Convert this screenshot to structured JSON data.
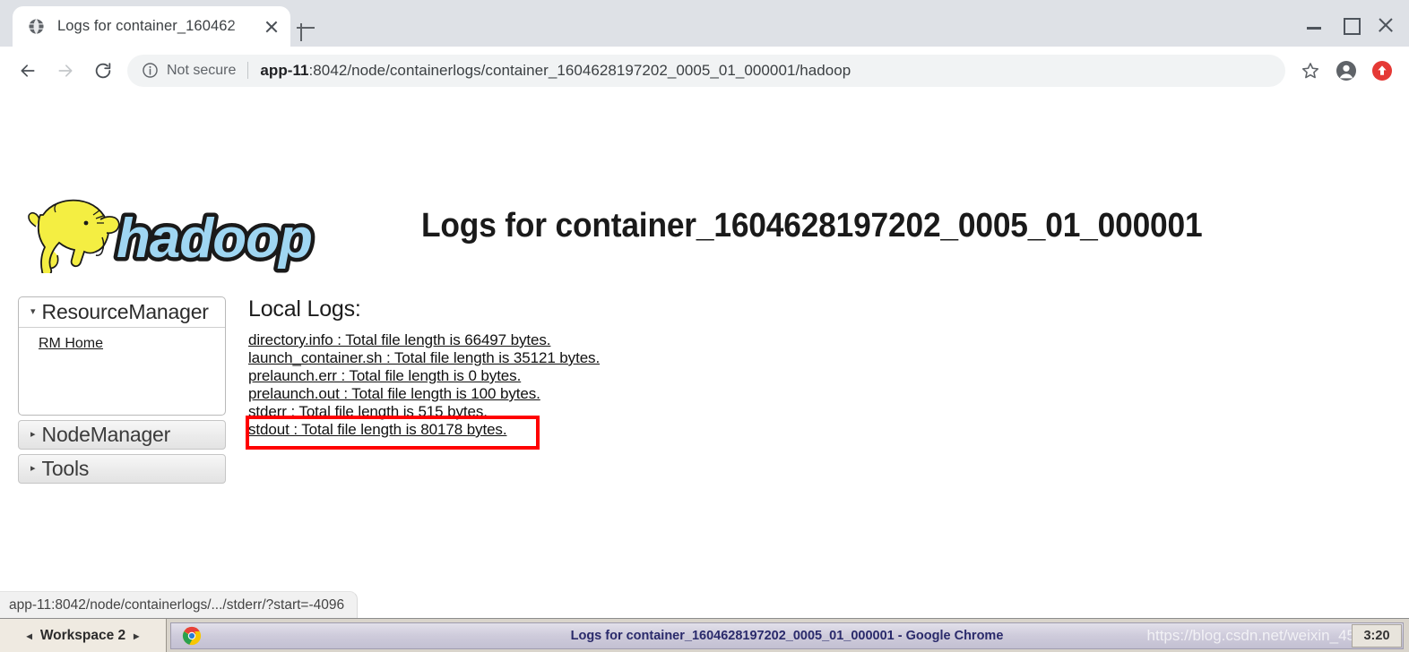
{
  "browser": {
    "tab": {
      "title": "Logs for container_160462",
      "favicon": "globe-icon",
      "close": "×"
    },
    "new_tab_label": "+",
    "window_controls": {
      "minimize": "minimize-icon",
      "maximize": "maximize-icon",
      "close": "close-icon"
    },
    "nav": {
      "back": "back-arrow-icon",
      "forward": "forward-arrow-icon",
      "reload": "reload-icon"
    },
    "omnibox": {
      "security_icon": "info-circle-icon",
      "security_label": "Not secure",
      "url_host": "app-11",
      "url_rest": ":8042/node/containerlogs/container_1604628197202_0005_01_000001/hadoop",
      "url_full": "app-11:8042/node/containerlogs/container_1604628197202_0005_01_000001/hadoop"
    },
    "toolbar_icons": {
      "bookmark": "star-icon",
      "profile": "avatar-icon",
      "update": "update-icon"
    },
    "status_bar": {
      "text": "app-11:8042/node/containerlogs/.../stderr/?start=-4096"
    }
  },
  "page": {
    "logo_alt": "hadoop-logo",
    "title": "Logs for container_1604628197202_0005_01_000001",
    "sidebar": {
      "expanded": {
        "caret": "▾",
        "label": "ResourceManager",
        "links": [
          {
            "label": "RM Home",
            "name": "rm-home-link"
          }
        ]
      },
      "collapsed": [
        {
          "caret": "▸",
          "label": "NodeManager",
          "name": "sidebar-section-nodemanager"
        },
        {
          "caret": "▸",
          "label": "Tools",
          "name": "sidebar-section-tools"
        }
      ]
    },
    "main": {
      "heading": "Local Logs:",
      "logs": [
        {
          "label": "directory.info : Total file length is 66497 bytes.",
          "file": "directory.info",
          "bytes": 66497
        },
        {
          "label": "launch_container.sh : Total file length is 35121 bytes.",
          "file": "launch_container.sh",
          "bytes": 35121
        },
        {
          "label": "prelaunch.err : Total file length is 0 bytes.",
          "file": "prelaunch.err",
          "bytes": 0
        },
        {
          "label": "prelaunch.out : Total file length is 100 bytes.",
          "file": "prelaunch.out",
          "bytes": 100
        },
        {
          "label": "stderr : Total file length is 515 bytes.",
          "file": "stderr",
          "bytes": 515
        },
        {
          "label": "stdout : Total file length is 80178 bytes.",
          "file": "stdout",
          "bytes": 80178
        }
      ],
      "highlight": {
        "color": "#ff0000",
        "target": "stdout : Total file length is 80178 bytes."
      }
    }
  },
  "taskbar": {
    "workspace": {
      "prev": "◂",
      "label": "Workspace 2",
      "next": "▸"
    },
    "task": {
      "icon": "chrome-icon",
      "title": "Logs for container_1604628197202_0005_01_000001 - Google Chrome"
    },
    "watermark": "https://blog.csdn.net/weixin_45",
    "clock": "3:20"
  }
}
